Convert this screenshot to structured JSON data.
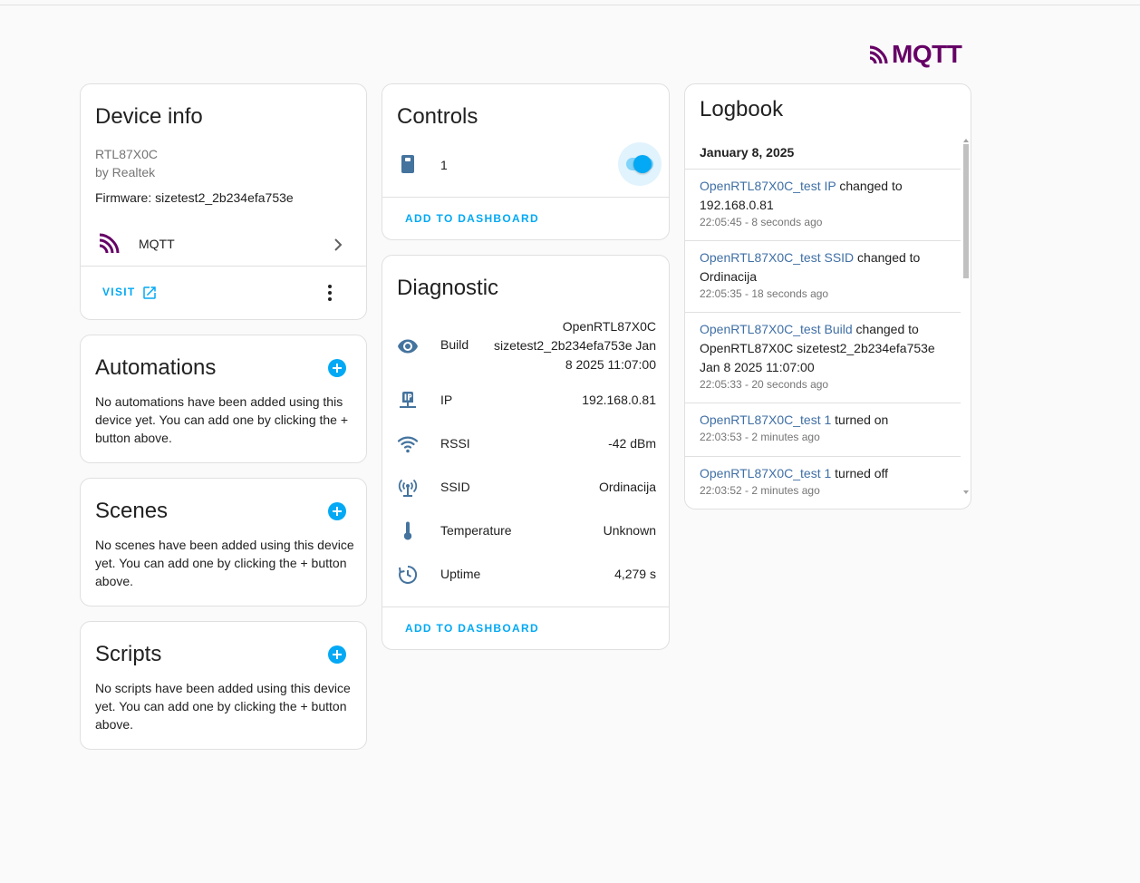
{
  "brand": {
    "name": "MQTT",
    "color": "#660066"
  },
  "device_info": {
    "title": "Device info",
    "model": "RTL87X0C",
    "manufacturer": "by Realtek",
    "firmware": "Firmware: sizetest2_2b234efa753e",
    "integration": "MQTT",
    "visit": "VISIT"
  },
  "automations": {
    "title": "Automations",
    "empty": "No automations have been added using this device yet. You can add one by clicking the + button above."
  },
  "scenes": {
    "title": "Scenes",
    "empty": "No scenes have been added using this device yet. You can add one by clicking the + button above."
  },
  "scripts": {
    "title": "Scripts",
    "empty": "No scripts have been added using this device yet. You can add one by clicking the + button above."
  },
  "controls": {
    "title": "Controls",
    "entity_name": "1",
    "toggle_on": true,
    "add_to_dashboard": "ADD TO DASHBOARD"
  },
  "diagnostic": {
    "title": "Diagnostic",
    "add_to_dashboard": "ADD TO DASHBOARD",
    "rows": [
      {
        "icon": "eye-icon",
        "name": "Build",
        "value_lines": [
          "OpenRTL87X0C",
          "sizetest2_2b234efa753e Jan",
          "8 2025 11:07:00"
        ]
      },
      {
        "icon": "ip-network-icon",
        "name": "IP",
        "value": "192.168.0.81"
      },
      {
        "icon": "wifi-icon",
        "name": "RSSI",
        "value": "-42 dBm"
      },
      {
        "icon": "access-point-icon",
        "name": "SSID",
        "value": "Ordinacija"
      },
      {
        "icon": "thermometer-icon",
        "name": "Temperature",
        "value": "Unknown"
      },
      {
        "icon": "clock-outline-icon",
        "name": "Uptime",
        "value": "4,279 s"
      }
    ]
  },
  "logbook": {
    "title": "Logbook",
    "date": "January 8, 2025",
    "entries": [
      {
        "entity": "OpenRTL87X0C_test IP",
        "line1_rest": " changed to",
        "line2": "192.168.0.81",
        "line3": "",
        "when": "22:05:45 - 8 seconds ago"
      },
      {
        "entity": "OpenRTL87X0C_test SSID",
        "line1_rest": " changed to",
        "line2": "Ordinacija",
        "line3": "",
        "when": "22:05:35 - 18 seconds ago"
      },
      {
        "entity": "OpenRTL87X0C_test Build",
        "line1_rest": " changed to",
        "line2": "OpenRTL87X0C sizetest2_2b234efa753e",
        "line3": "Jan 8 2025 11:07:00",
        "when": "22:05:33 - 20 seconds ago"
      },
      {
        "entity": "OpenRTL87X0C_test 1",
        "line1_rest": " turned on",
        "line2": "",
        "line3": "",
        "when": "22:03:53 - 2 minutes ago"
      },
      {
        "entity": "OpenRTL87X0C_test 1",
        "line1_rest": " turned off",
        "line2": "",
        "line3": "",
        "when": "22:03:52 - 2 minutes ago"
      }
    ]
  },
  "colors": {
    "accent": "#03a9f4",
    "entity_link": "#3f6fa5",
    "icon": "#44739e"
  }
}
